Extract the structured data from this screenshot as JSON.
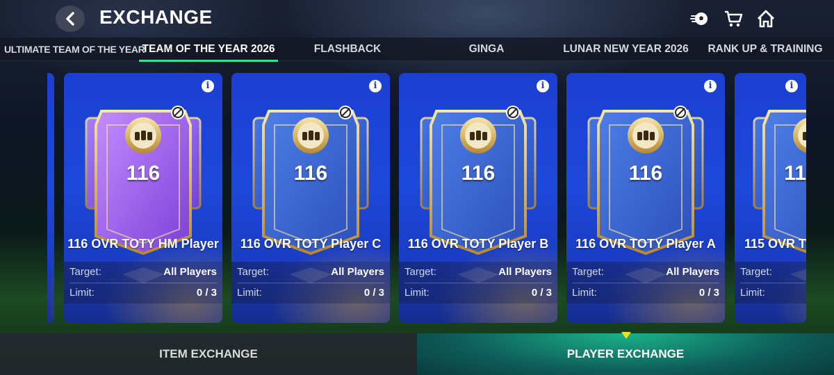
{
  "header": {
    "title": "EXCHANGE",
    "icons": [
      "back-icon",
      "soccer-ball-icon",
      "cart-icon",
      "home-icon"
    ]
  },
  "tabs": [
    {
      "label": "ULTIMATE TEAM OF THE YEAR",
      "active": false
    },
    {
      "label": "TEAM OF THE YEAR 2026",
      "active": true
    },
    {
      "label": "FLASHBACK",
      "active": false
    },
    {
      "label": "GINGA",
      "active": false
    },
    {
      "label": "LUNAR NEW YEAR 2026",
      "active": false
    },
    {
      "label": "RANK UP & TRAINING",
      "active": false
    }
  ],
  "cards": [
    {
      "ovr": "116",
      "name": "116 OVR TOTY HM Player",
      "target_label": "Target:",
      "target": "All Players",
      "limit_label": "Limit:",
      "limit": "0 / 3",
      "variant": "purple"
    },
    {
      "ovr": "116",
      "name": "116 OVR TOTY Player C",
      "target_label": "Target:",
      "target": "All Players",
      "limit_label": "Limit:",
      "limit": "0 / 3",
      "variant": "blue"
    },
    {
      "ovr": "116",
      "name": "116 OVR TOTY Player B",
      "target_label": "Target:",
      "target": "All Players",
      "limit_label": "Limit:",
      "limit": "0 / 3",
      "variant": "blue"
    },
    {
      "ovr": "116",
      "name": "116 OVR TOTY Player A",
      "target_label": "Target:",
      "target": "All Players",
      "limit_label": "Limit:",
      "limit": "0 / 3",
      "variant": "blue"
    },
    {
      "ovr": "11",
      "name": "115 OVR T",
      "target_label": "Target:",
      "target": "",
      "limit_label": "Limit:",
      "limit": "",
      "variant": "blue"
    }
  ],
  "bottom": {
    "item_exchange": "ITEM EXCHANGE",
    "player_exchange": "PLAYER EXCHANGE"
  },
  "colors": {
    "accent_green": "#2ee886",
    "card_blue": "#1d48da",
    "pointer_yellow": "#f3e21a"
  }
}
